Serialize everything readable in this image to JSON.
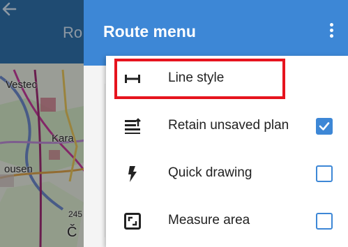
{
  "map": {
    "title": "Ro",
    "labels": [
      "Vestec",
      "Kara",
      "ousen",
      "Č",
      "245"
    ]
  },
  "route_menu": {
    "title": "Route menu",
    "items": [
      {
        "label": "Line style",
        "icon": "line-style-icon"
      },
      {
        "label": "Retain unsaved plan",
        "icon": "retain-plan-icon",
        "checked": true
      },
      {
        "label": "Quick drawing",
        "icon": "lightning-icon",
        "checked": false
      },
      {
        "label": "Measure area",
        "icon": "measure-area-icon",
        "checked": false
      }
    ]
  },
  "colors": {
    "appbar": "#3d87d6",
    "highlight": "#e6141e",
    "checkbox": "#3d87d6"
  }
}
